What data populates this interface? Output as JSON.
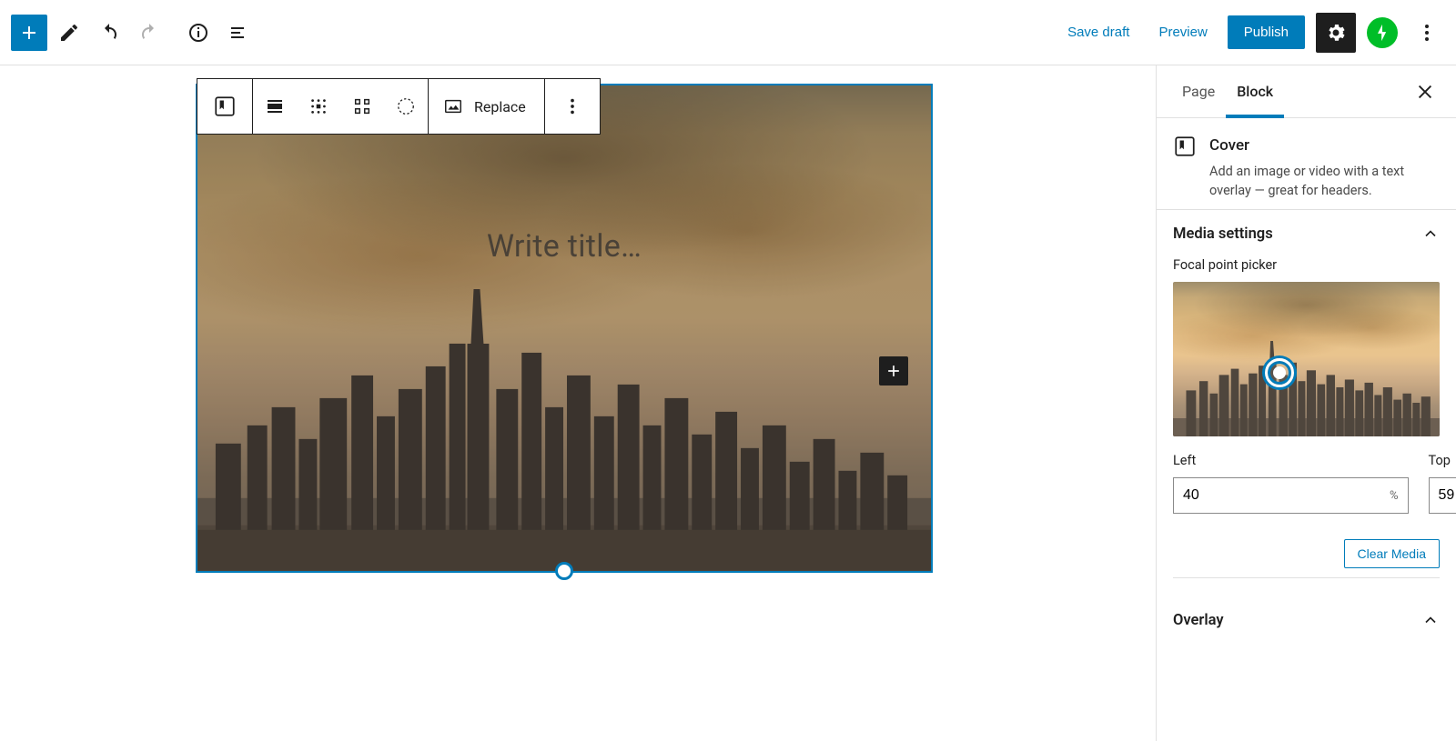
{
  "header": {
    "save_draft": "Save draft",
    "preview": "Preview",
    "publish": "Publish"
  },
  "block_toolbar": {
    "replace": "Replace"
  },
  "cover": {
    "title_placeholder": "Write title…"
  },
  "sidebar": {
    "tabs": {
      "page": "Page",
      "block": "Block",
      "active": "block"
    },
    "block_card": {
      "title": "Cover",
      "description": "Add an image or video with a text overlay — great for headers."
    },
    "media_settings": {
      "heading": "Media settings",
      "focal_label": "Focal point picker",
      "left_label": "Left",
      "top_label": "Top",
      "left_value": "40",
      "top_value": "59",
      "unit": "%",
      "clear_media": "Clear Media"
    },
    "overlay": {
      "heading": "Overlay"
    }
  },
  "icons": {
    "add": "add-icon",
    "edit": "pencil-icon",
    "undo": "undo-icon",
    "redo": "redo-icon",
    "info": "info-icon",
    "outline": "list-view-icon",
    "settings": "gear-icon",
    "jetpack": "jetpack-icon",
    "more": "more-vertical-icon",
    "close": "close-icon",
    "cover": "cover-block-icon",
    "align": "align-icon",
    "pos": "content-position-icon",
    "full": "fullwidth-icon",
    "duotone": "duotone-icon",
    "image": "image-icon",
    "chevron": "chevron-up-icon"
  }
}
